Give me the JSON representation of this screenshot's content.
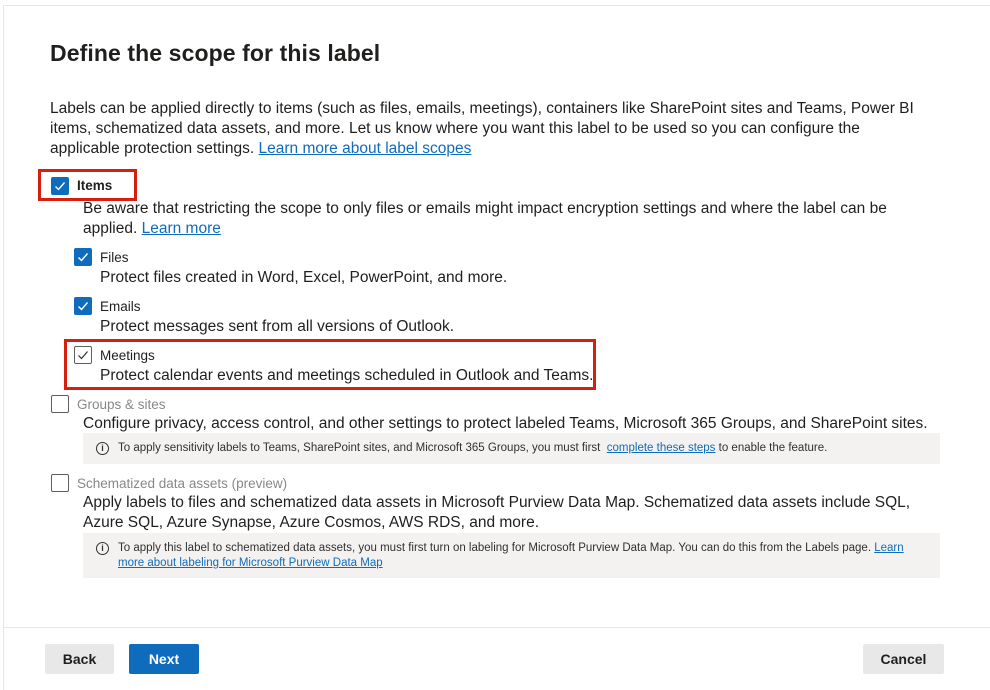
{
  "page": {
    "title": "Define the scope for this label",
    "intro_text": "Labels can be applied directly to items (such as files, emails, meetings), containers like SharePoint sites and Teams, Power BI items, schematized data assets, and more. Let us know where you want this label to be used so you can configure the applicable protection settings.",
    "intro_link": "Learn more about label scopes"
  },
  "items": {
    "label": "Items",
    "checked": true,
    "warning_text": "Be aware that restricting the scope to only files or emails might impact encryption settings and where the label can be applied.",
    "warning_link": "Learn more",
    "files": {
      "label": "Files",
      "desc": "Protect files created in Word, Excel, PowerPoint, and more.",
      "checked": true
    },
    "emails": {
      "label": "Emails",
      "desc": "Protect messages sent from all versions of Outlook.",
      "checked": true
    },
    "meetings": {
      "label": "Meetings",
      "desc": "Protect calendar events and meetings scheduled in Outlook and Teams.",
      "checked": true
    }
  },
  "groups_sites": {
    "label": "Groups & sites",
    "checked": false,
    "desc": "Configure privacy, access control, and other settings to protect labeled Teams, Microsoft 365 Groups, and SharePoint sites.",
    "info_text": "To apply sensitivity labels to Teams, SharePoint sites, and Microsoft 365 Groups, you must first",
    "info_link": "complete these steps",
    "info_suffix": "to enable the feature."
  },
  "schematized": {
    "label": "Schematized data assets (preview)",
    "checked": false,
    "desc": "Apply labels to files and schematized data assets in Microsoft Purview Data Map. Schematized data assets include SQL, Azure SQL, Azure Synapse, Azure Cosmos, AWS RDS, and more.",
    "info_text": "To apply this label to schematized data assets, you must first turn on labeling for Microsoft Purview Data Map. You can do this from the Labels page.",
    "info_link": "Learn more about labeling for Microsoft Purview Data Map"
  },
  "footer": {
    "back_label": "Back",
    "next_label": "Next",
    "cancel_label": "Cancel"
  },
  "colors": {
    "accent": "#0f6cbd",
    "highlight_box": "#d71f0f",
    "info_bg": "#f3f2f1"
  }
}
